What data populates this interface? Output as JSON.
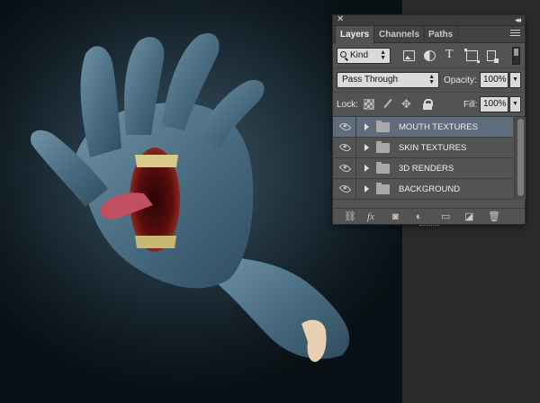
{
  "panel": {
    "close_icon": "close-icon",
    "collapse_icon": "collapse-icon",
    "tabs": [
      {
        "label": "Layers",
        "active": true
      },
      {
        "label": "Channels",
        "active": false
      },
      {
        "label": "Paths",
        "active": false
      }
    ],
    "filter": {
      "kind_value": "Kind",
      "icons": [
        "image-filter-icon",
        "adjustment-filter-icon",
        "type-filter-icon",
        "shape-filter-icon",
        "smart-object-filter-icon"
      ]
    },
    "blend_mode": "Pass Through",
    "opacity_label": "Opacity:",
    "opacity_value": "100%",
    "lock_label": "Lock:",
    "fill_label": "Fill:",
    "fill_value": "100%",
    "layers": [
      {
        "name": "MOUTH TEXTURES",
        "selected": true,
        "visible": true
      },
      {
        "name": "SKIN TEXTURES",
        "selected": false,
        "visible": true
      },
      {
        "name": "3D RENDERS",
        "selected": false,
        "visible": true
      },
      {
        "name": "BACKGROUND",
        "selected": false,
        "visible": true
      }
    ],
    "footer_icons": {
      "fx": "fx"
    }
  },
  "colors": {
    "panel_bg": "#535353",
    "selected_row": "#5f6c7c",
    "hand": "#4f7388"
  }
}
